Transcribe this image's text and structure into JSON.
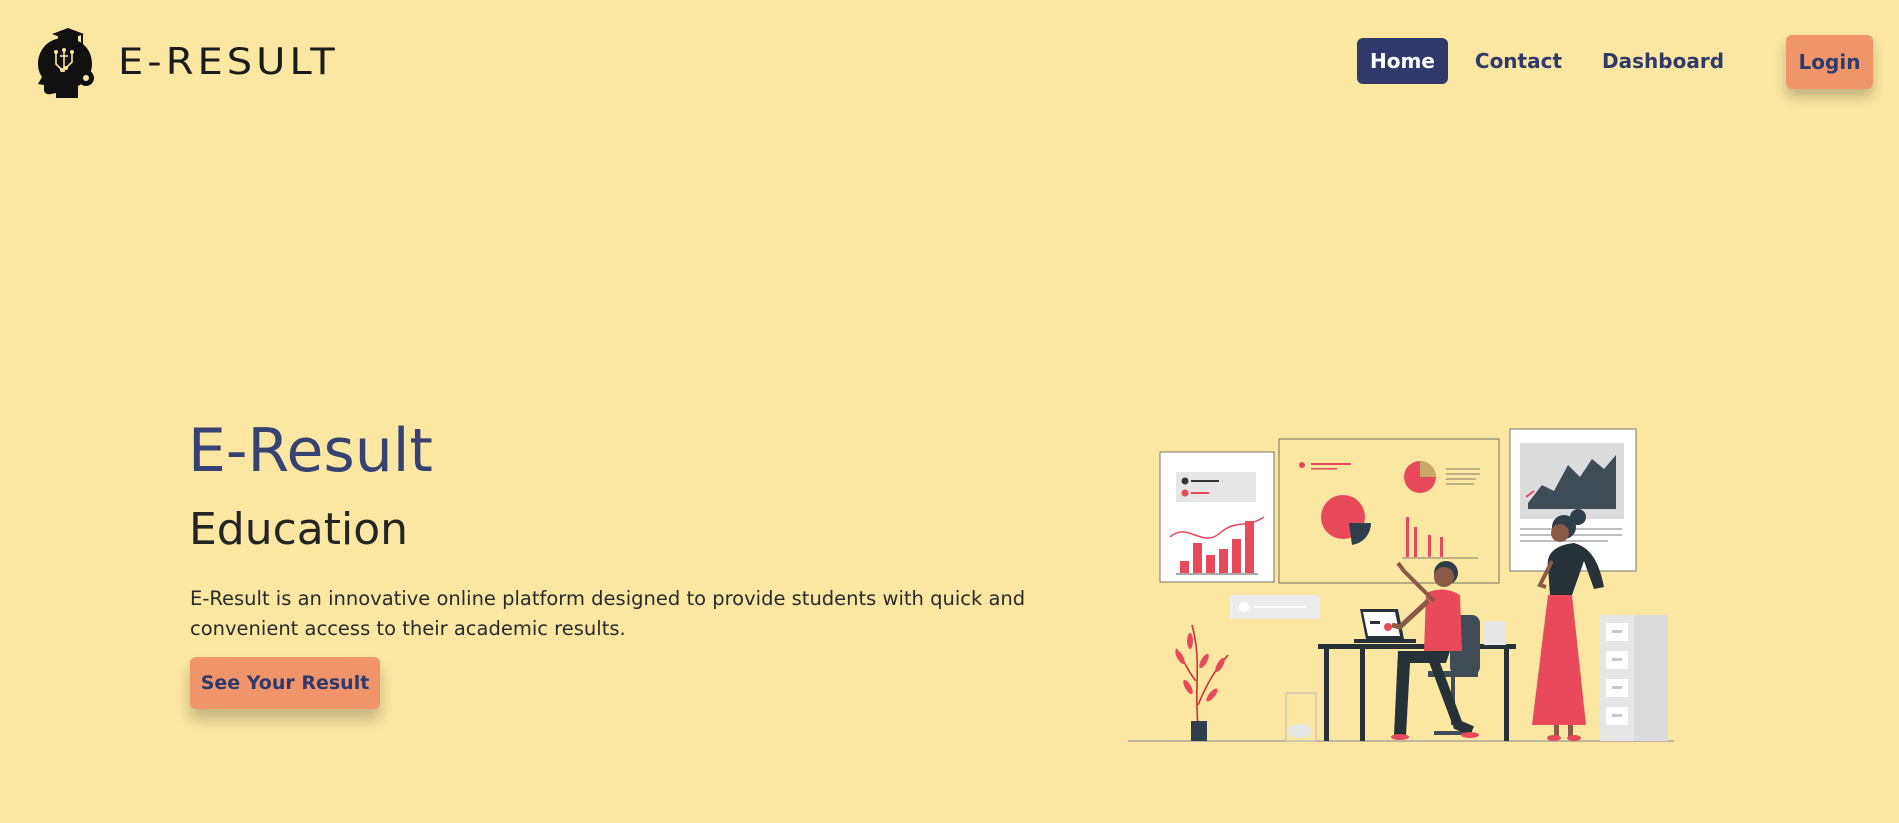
{
  "header": {
    "brand": "E-RESULT",
    "nav": [
      {
        "label": "Home",
        "active": true
      },
      {
        "label": "Contact",
        "active": false
      },
      {
        "label": "Dashboard",
        "active": false
      }
    ],
    "login_label": "Login"
  },
  "hero": {
    "title": "E-Result",
    "subtitle": "Education",
    "description": "E-Result is an innovative online platform designed to provide students with quick and convenient access to their academic results.",
    "cta_label": "See Your Result"
  },
  "icons": {
    "logo": "graduate-head-logo-icon",
    "illustration": "data-analytics-illustration"
  },
  "colors": {
    "background": "#fbe6a2",
    "primary": "#2f3a6b",
    "accent": "#f0946a",
    "chart_red": "#e8495b"
  }
}
